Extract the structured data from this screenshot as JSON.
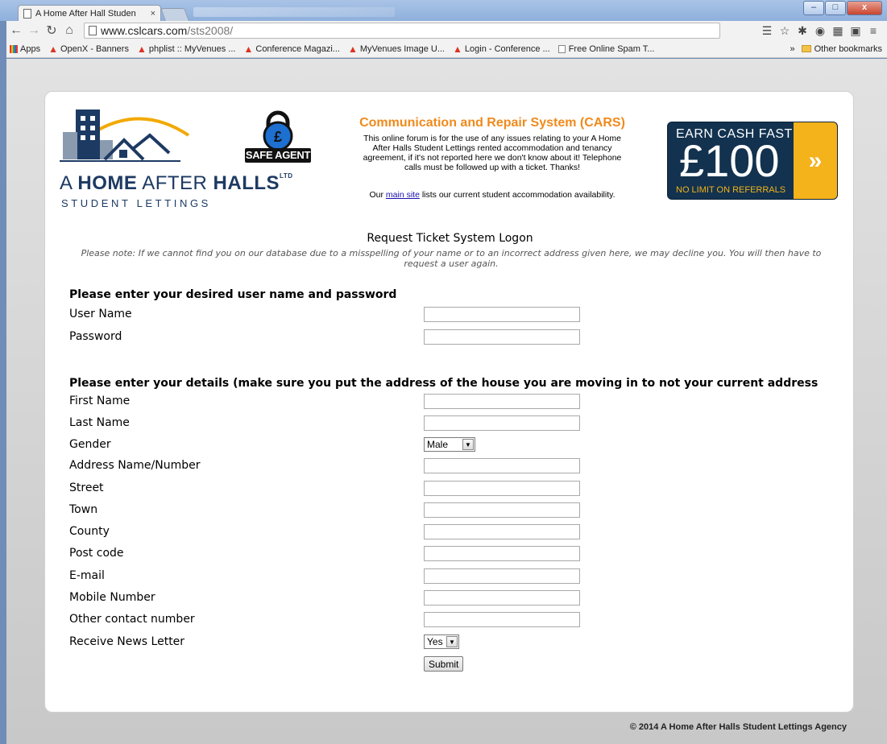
{
  "browser": {
    "tab_title": "A Home After Hall Studen",
    "tab_close": "×",
    "url_host": "www.cslcars.com",
    "url_path": "/sts2008/",
    "bookmarks": [
      {
        "label": "Apps",
        "icon": "apps-grid-icon"
      },
      {
        "label": "OpenX - Banners",
        "icon": "mark-icon"
      },
      {
        "label": "phplist :: MyVenues ...",
        "icon": "mark-icon"
      },
      {
        "label": "Conference Magazi...",
        "icon": "mark-icon"
      },
      {
        "label": "MyVenues Image U...",
        "icon": "mark-icon"
      },
      {
        "label": "Login - Conference ...",
        "icon": "mark-icon"
      },
      {
        "label": "Free Online Spam T...",
        "icon": "page-icon"
      }
    ],
    "bookmarks_overflow": "»",
    "other_bookmarks": "Other bookmarks",
    "window_controls": {
      "minimize": "–",
      "maximize": "□",
      "close": "x"
    }
  },
  "header": {
    "logo_brand_prefix": "A ",
    "logo_brand_bold1": "HOME",
    "logo_brand_mid": " AFTER ",
    "logo_brand_bold2": "HALLS",
    "logo_brand_sup": "LTD",
    "logo_sub": "STUDENT LETTINGS",
    "safe_agent_symbol": "£",
    "safe_agent_label": "SAFE AGENT",
    "cars_title": "Communication and Repair System (CARS)",
    "cars_desc": "This online forum is for the use of any issues relating to your A Home After Halls Student Lettings rented accommodation and tenancy agreement, if it's not reported here we don't know about it! Telephone calls must be followed up with a ticket. Thanks!",
    "main_site_prefix": "Our ",
    "main_site_link": "main site",
    "main_site_suffix": " lists our current student accommodation availability.",
    "promo_top": "EARN CASH FAST",
    "promo_amount": "£100",
    "promo_bottom": "NO LIMIT ON REFERRALS",
    "promo_arrow": "»"
  },
  "logon": {
    "title": "Request Ticket System Logon",
    "note": "Please note: If we cannot find you on our database due to a misspelling of your name or to an incorrect address given here, we may decline you. You will then have to request a user again."
  },
  "form": {
    "credentials_heading": "Please enter your desired user name and password",
    "credentials": [
      {
        "label": "User Name",
        "value": ""
      },
      {
        "label": "Password",
        "value": ""
      }
    ],
    "details_heading": "Please enter your details (make sure you put the address of the house you are moving in to not your current address",
    "details": [
      {
        "label": "First Name",
        "value": ""
      },
      {
        "label": "Last Name",
        "value": ""
      },
      {
        "label": "Gender",
        "value": "Male"
      },
      {
        "label": "Address Name/Number",
        "value": ""
      },
      {
        "label": "Street",
        "value": ""
      },
      {
        "label": "Town",
        "value": ""
      },
      {
        "label": "County",
        "value": ""
      },
      {
        "label": "Post code",
        "value": ""
      },
      {
        "label": "E-mail",
        "value": ""
      },
      {
        "label": "Mobile Number",
        "value": ""
      },
      {
        "label": "Other contact number",
        "value": ""
      },
      {
        "label": "Receive News Letter",
        "value": "Yes"
      }
    ],
    "submit_label": "Submit"
  },
  "footer": {
    "copyright": "© 2014 A Home After Halls Student Lettings Agency"
  }
}
